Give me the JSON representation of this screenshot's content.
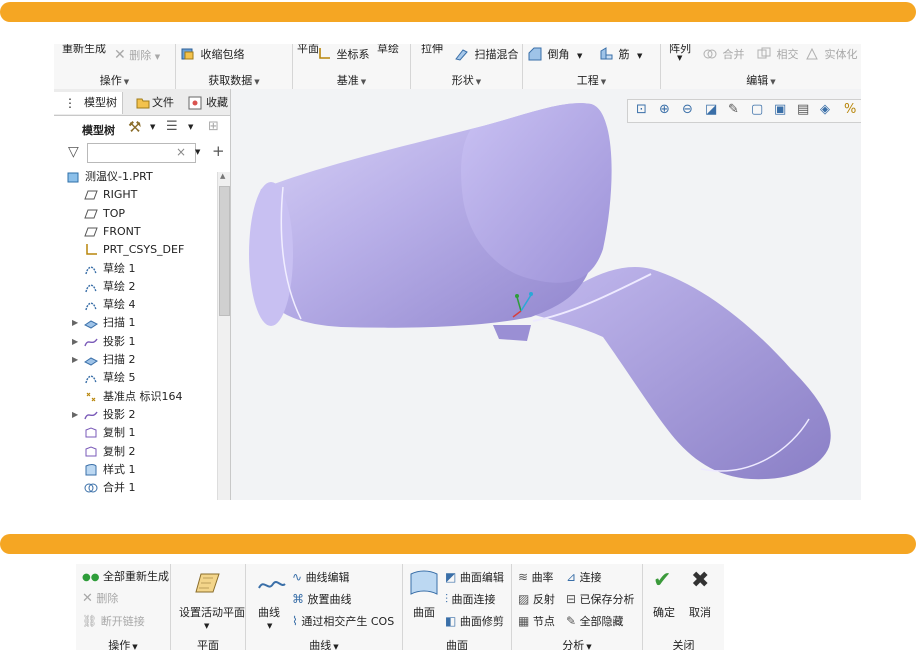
{
  "accent_color": "#f5a623",
  "top_ribbon": {
    "groups": [
      {
        "label": "操作",
        "clipped_top": "重新生成",
        "commands": [
          {
            "label": "删除",
            "disabled": true
          }
        ]
      },
      {
        "label": "获取数据",
        "commands": [
          {
            "label": "收缩包络",
            "disabled": false
          }
        ]
      },
      {
        "label": "基准",
        "clipped_top": "平面",
        "clipped_top2": "草绘",
        "commands": [
          {
            "label": "坐标系",
            "disabled": false
          }
        ]
      },
      {
        "label": "形状",
        "clipped_top": "拉伸",
        "commands": [
          {
            "label": "扫描混合",
            "disabled": false
          }
        ]
      },
      {
        "label": "工程",
        "commands": [
          {
            "label": "倒角",
            "disabled": false
          },
          {
            "label": "筋",
            "disabled": false
          }
        ]
      },
      {
        "label": "编辑",
        "clipped_top": "阵列",
        "commands": [
          {
            "label": "合并",
            "disabled": true
          },
          {
            "label": "相交",
            "disabled": true
          },
          {
            "label": "实体化",
            "disabled": true
          }
        ]
      }
    ]
  },
  "left_panel": {
    "tabs": [
      {
        "label": "模型树"
      },
      {
        "label": "文件"
      },
      {
        "label": "收藏"
      }
    ],
    "tree_label": "模型树",
    "search_placeholder": "",
    "tree_items": [
      {
        "label": "测温仪-1.PRT",
        "icon": "part-icon",
        "expandable": false,
        "level": 0
      },
      {
        "label": "RIGHT",
        "icon": "datum-plane-icon",
        "expandable": false,
        "level": 1
      },
      {
        "label": "TOP",
        "icon": "datum-plane-icon",
        "expandable": false,
        "level": 1
      },
      {
        "label": "FRONT",
        "icon": "datum-plane-icon",
        "expandable": false,
        "level": 1
      },
      {
        "label": "PRT_CSYS_DEF",
        "icon": "csys-icon",
        "expandable": false,
        "level": 1
      },
      {
        "label": "草绘 1",
        "icon": "sketch-icon",
        "expandable": false,
        "level": 1
      },
      {
        "label": "草绘 2",
        "icon": "sketch-icon",
        "expandable": false,
        "level": 1
      },
      {
        "label": "草绘 4",
        "icon": "sketch-icon",
        "expandable": false,
        "level": 1
      },
      {
        "label": "扫描 1",
        "icon": "sweep-icon",
        "expandable": true,
        "level": 1
      },
      {
        "label": "投影 1",
        "icon": "projection-icon",
        "expandable": true,
        "level": 1
      },
      {
        "label": "扫描 2",
        "icon": "sweep-icon",
        "expandable": true,
        "level": 1
      },
      {
        "label": "草绘 5",
        "icon": "sketch-icon",
        "expandable": false,
        "level": 1
      },
      {
        "label": "基准点 标识164",
        "icon": "datum-point-icon",
        "expandable": false,
        "level": 1
      },
      {
        "label": "投影 2",
        "icon": "projection-icon",
        "expandable": true,
        "level": 1
      },
      {
        "label": "复制 1",
        "icon": "copy-icon",
        "expandable": false,
        "level": 1
      },
      {
        "label": "复制 2",
        "icon": "copy-icon",
        "expandable": false,
        "level": 1
      },
      {
        "label": "样式 1",
        "icon": "style-icon",
        "expandable": false,
        "level": 1
      },
      {
        "label": "合并 1",
        "icon": "merge-icon",
        "expandable": false,
        "level": 1
      }
    ]
  },
  "view_toolbar": {
    "icons": [
      "refit-icon",
      "zoom-in-icon",
      "zoom-out-icon",
      "repaint-icon",
      "reorient-icon",
      "saved-views-icon",
      "view-manager-icon",
      "display-style-icon",
      "perspective-icon",
      "datum-display-icon"
    ]
  },
  "model_color": "#b7aee6",
  "bottom_ribbon": {
    "groups": [
      {
        "label": "操作",
        "commands": [
          {
            "label": "全部重新生成",
            "disabled": false
          },
          {
            "label": "删除",
            "disabled": true
          },
          {
            "label": "断开链接",
            "disabled": true
          }
        ]
      },
      {
        "label": "平面",
        "commands": [
          {
            "label": "设置活动平面",
            "disabled": false
          }
        ]
      },
      {
        "label": "曲线",
        "commands": [
          {
            "label": "曲线",
            "disabled": false
          },
          {
            "label": "曲线编辑",
            "disabled": false
          },
          {
            "label": "放置曲线",
            "disabled": false
          },
          {
            "label": "通过相交产生 COS",
            "disabled": false
          }
        ]
      },
      {
        "label": "曲面",
        "commands": [
          {
            "label": "曲面",
            "disabled": false
          },
          {
            "label": "曲面编辑",
            "disabled": false
          },
          {
            "label": "曲面连接",
            "disabled": false
          },
          {
            "label": "曲面修剪",
            "disabled": false
          }
        ]
      },
      {
        "label": "分析",
        "commands": [
          {
            "label": "曲率",
            "disabled": false
          },
          {
            "label": "连接",
            "disabled": false
          },
          {
            "label": "反射",
            "disabled": false
          },
          {
            "label": "已保存分析",
            "disabled": false
          },
          {
            "label": "节点",
            "disabled": false
          },
          {
            "label": "全部隐藏",
            "disabled": false
          }
        ]
      },
      {
        "label": "关闭",
        "commands": [
          {
            "label": "确定",
            "disabled": false
          },
          {
            "label": "取消",
            "disabled": false
          }
        ]
      }
    ]
  }
}
